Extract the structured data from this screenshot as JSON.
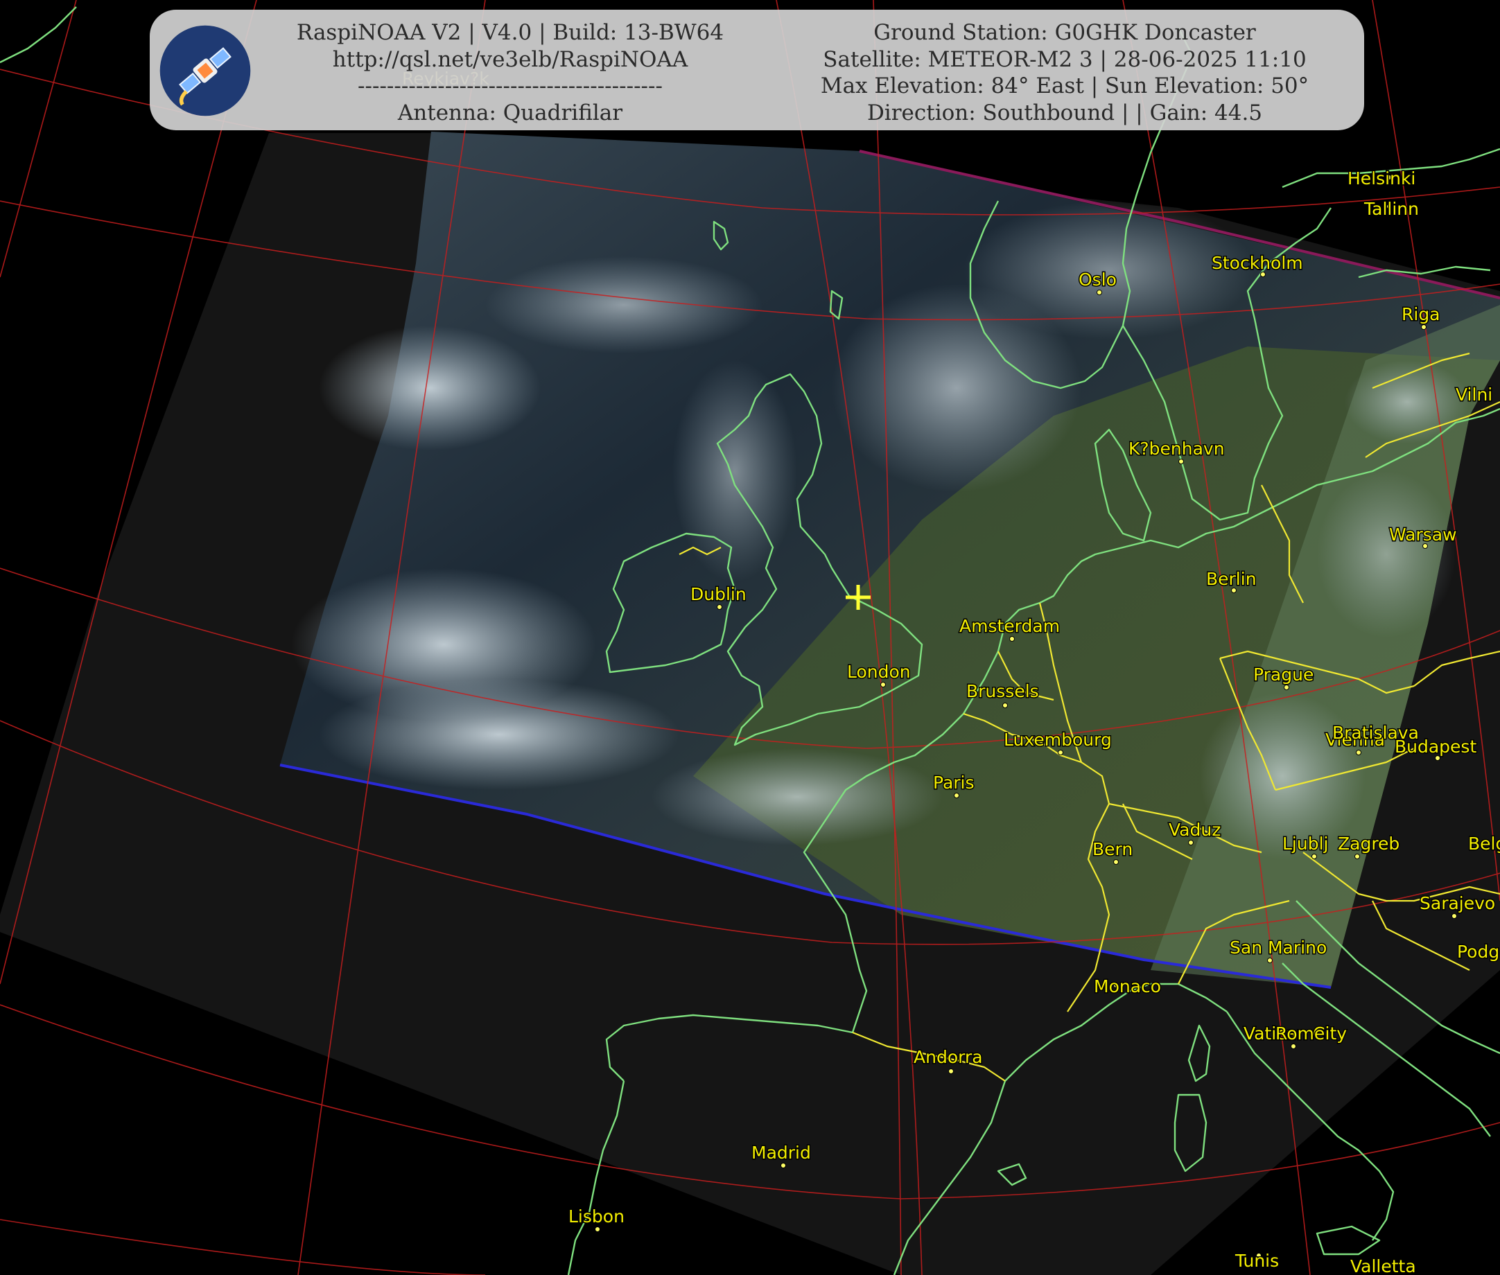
{
  "header": {
    "left_lines": [
      "RaspiNOAA V2 | V4.0 | Build: 13-BW64",
      "http://qsl.net/ve3elb/RaspiNOAA",
      "------------------------------------------",
      "Antenna: Quadrifilar"
    ],
    "right_lines": [
      "Ground Station: G0GHK Doncaster",
      "Satellite: METEOR-M2 3 | 28-06-2025 11:10",
      "Max Elevation: 84° East | Sun Elevation: 50°",
      "Direction: Southbound | | Gain: 44.5"
    ]
  },
  "cities": [
    {
      "name": "Reykjav?k",
      "dim": true
    },
    {
      "name": "Helsinki"
    },
    {
      "name": "Tallinn"
    },
    {
      "name": "Stockholm"
    },
    {
      "name": "Oslo"
    },
    {
      "name": "Riga"
    },
    {
      "name": "Vilni"
    },
    {
      "name": "K?benhavn"
    },
    {
      "name": "Warsaw"
    },
    {
      "name": "Berlin"
    },
    {
      "name": "Dublin"
    },
    {
      "name": "Amsterdam"
    },
    {
      "name": "London"
    },
    {
      "name": "Brussels"
    },
    {
      "name": "Prague"
    },
    {
      "name": "Luxembourg"
    },
    {
      "name": "Vienna"
    },
    {
      "name": "Bratislava"
    },
    {
      "name": "Budapest"
    },
    {
      "name": "Paris"
    },
    {
      "name": "Vaduz"
    },
    {
      "name": "Bern"
    },
    {
      "name": "Ljublj"
    },
    {
      "name": "Zagreb"
    },
    {
      "name": "Belg"
    },
    {
      "name": "Sarajevo"
    },
    {
      "name": "San Marino"
    },
    {
      "name": "Podg"
    },
    {
      "name": "Monaco"
    },
    {
      "name": "Vatican City"
    },
    {
      "name": "Rome"
    },
    {
      "name": "Andorra"
    },
    {
      "name": "Madrid"
    },
    {
      "name": "Lisbon"
    },
    {
      "name": "Tunis"
    },
    {
      "name": "Valletta"
    }
  ],
  "colors": {
    "coastline": "#7fe07f",
    "borders": "#f0e832",
    "graticule": "#c81e1e",
    "labels": "#f5f000"
  },
  "icons": {
    "logo": "satellite-icon",
    "station_marker": "plus-marker-icon"
  }
}
